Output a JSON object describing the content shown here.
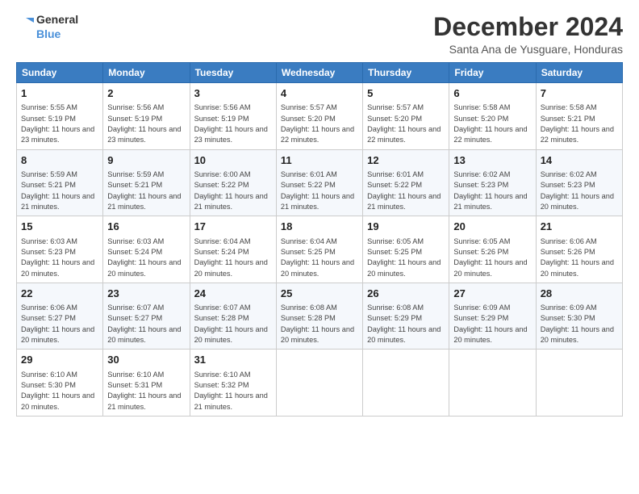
{
  "header": {
    "logo_line1": "General",
    "logo_line2": "Blue",
    "month_title": "December 2024",
    "subtitle": "Santa Ana de Yusguare, Honduras"
  },
  "days_of_week": [
    "Sunday",
    "Monday",
    "Tuesday",
    "Wednesday",
    "Thursday",
    "Friday",
    "Saturday"
  ],
  "weeks": [
    [
      {
        "day": "1",
        "sunrise": "5:55 AM",
        "sunset": "5:19 PM",
        "daylight": "11 hours and 23 minutes."
      },
      {
        "day": "2",
        "sunrise": "5:56 AM",
        "sunset": "5:19 PM",
        "daylight": "11 hours and 23 minutes."
      },
      {
        "day": "3",
        "sunrise": "5:56 AM",
        "sunset": "5:19 PM",
        "daylight": "11 hours and 23 minutes."
      },
      {
        "day": "4",
        "sunrise": "5:57 AM",
        "sunset": "5:20 PM",
        "daylight": "11 hours and 22 minutes."
      },
      {
        "day": "5",
        "sunrise": "5:57 AM",
        "sunset": "5:20 PM",
        "daylight": "11 hours and 22 minutes."
      },
      {
        "day": "6",
        "sunrise": "5:58 AM",
        "sunset": "5:20 PM",
        "daylight": "11 hours and 22 minutes."
      },
      {
        "day": "7",
        "sunrise": "5:58 AM",
        "sunset": "5:21 PM",
        "daylight": "11 hours and 22 minutes."
      }
    ],
    [
      {
        "day": "8",
        "sunrise": "5:59 AM",
        "sunset": "5:21 PM",
        "daylight": "11 hours and 21 minutes."
      },
      {
        "day": "9",
        "sunrise": "5:59 AM",
        "sunset": "5:21 PM",
        "daylight": "11 hours and 21 minutes."
      },
      {
        "day": "10",
        "sunrise": "6:00 AM",
        "sunset": "5:22 PM",
        "daylight": "11 hours and 21 minutes."
      },
      {
        "day": "11",
        "sunrise": "6:01 AM",
        "sunset": "5:22 PM",
        "daylight": "11 hours and 21 minutes."
      },
      {
        "day": "12",
        "sunrise": "6:01 AM",
        "sunset": "5:22 PM",
        "daylight": "11 hours and 21 minutes."
      },
      {
        "day": "13",
        "sunrise": "6:02 AM",
        "sunset": "5:23 PM",
        "daylight": "11 hours and 21 minutes."
      },
      {
        "day": "14",
        "sunrise": "6:02 AM",
        "sunset": "5:23 PM",
        "daylight": "11 hours and 20 minutes."
      }
    ],
    [
      {
        "day": "15",
        "sunrise": "6:03 AM",
        "sunset": "5:23 PM",
        "daylight": "11 hours and 20 minutes."
      },
      {
        "day": "16",
        "sunrise": "6:03 AM",
        "sunset": "5:24 PM",
        "daylight": "11 hours and 20 minutes."
      },
      {
        "day": "17",
        "sunrise": "6:04 AM",
        "sunset": "5:24 PM",
        "daylight": "11 hours and 20 minutes."
      },
      {
        "day": "18",
        "sunrise": "6:04 AM",
        "sunset": "5:25 PM",
        "daylight": "11 hours and 20 minutes."
      },
      {
        "day": "19",
        "sunrise": "6:05 AM",
        "sunset": "5:25 PM",
        "daylight": "11 hours and 20 minutes."
      },
      {
        "day": "20",
        "sunrise": "6:05 AM",
        "sunset": "5:26 PM",
        "daylight": "11 hours and 20 minutes."
      },
      {
        "day": "21",
        "sunrise": "6:06 AM",
        "sunset": "5:26 PM",
        "daylight": "11 hours and 20 minutes."
      }
    ],
    [
      {
        "day": "22",
        "sunrise": "6:06 AM",
        "sunset": "5:27 PM",
        "daylight": "11 hours and 20 minutes."
      },
      {
        "day": "23",
        "sunrise": "6:07 AM",
        "sunset": "5:27 PM",
        "daylight": "11 hours and 20 minutes."
      },
      {
        "day": "24",
        "sunrise": "6:07 AM",
        "sunset": "5:28 PM",
        "daylight": "11 hours and 20 minutes."
      },
      {
        "day": "25",
        "sunrise": "6:08 AM",
        "sunset": "5:28 PM",
        "daylight": "11 hours and 20 minutes."
      },
      {
        "day": "26",
        "sunrise": "6:08 AM",
        "sunset": "5:29 PM",
        "daylight": "11 hours and 20 minutes."
      },
      {
        "day": "27",
        "sunrise": "6:09 AM",
        "sunset": "5:29 PM",
        "daylight": "11 hours and 20 minutes."
      },
      {
        "day": "28",
        "sunrise": "6:09 AM",
        "sunset": "5:30 PM",
        "daylight": "11 hours and 20 minutes."
      }
    ],
    [
      {
        "day": "29",
        "sunrise": "6:10 AM",
        "sunset": "5:30 PM",
        "daylight": "11 hours and 20 minutes."
      },
      {
        "day": "30",
        "sunrise": "6:10 AM",
        "sunset": "5:31 PM",
        "daylight": "11 hours and 21 minutes."
      },
      {
        "day": "31",
        "sunrise": "6:10 AM",
        "sunset": "5:32 PM",
        "daylight": "11 hours and 21 minutes."
      },
      null,
      null,
      null,
      null
    ]
  ]
}
